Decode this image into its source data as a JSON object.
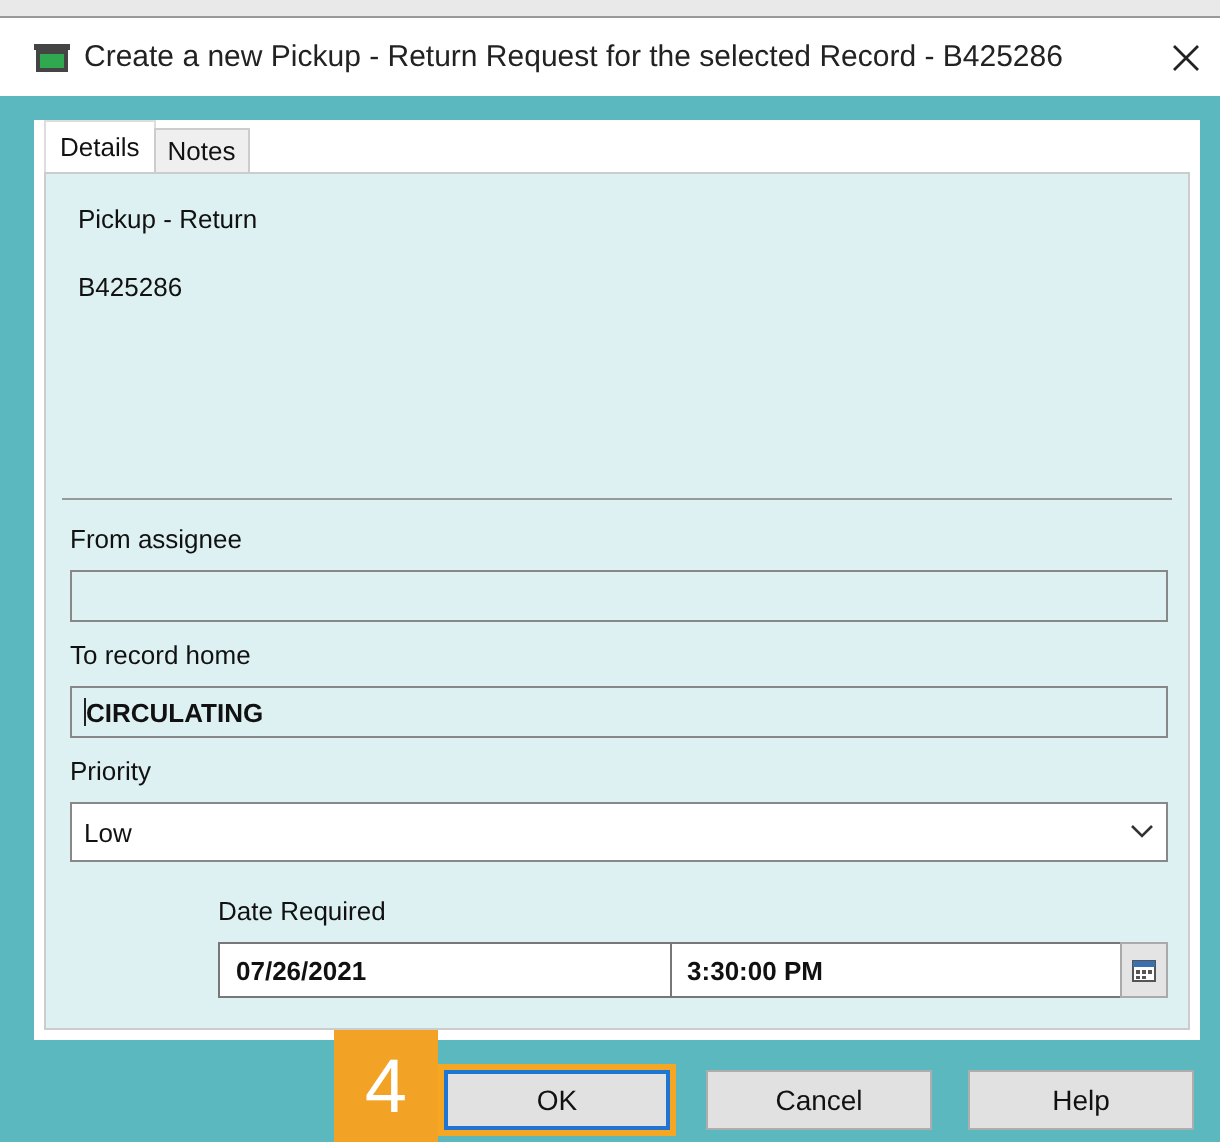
{
  "window": {
    "title": "Create a new Pickup - Return Request for the selected Record - B425286"
  },
  "tabs": [
    {
      "label": "Details",
      "selected": true
    },
    {
      "label": "Notes",
      "selected": false
    }
  ],
  "request_type": "Pickup - Return",
  "record_number": "B425286",
  "fields": [
    {
      "label": "From assignee"
    },
    {
      "label": "To record home",
      "value": "CIRCULATING"
    }
  ],
  "priority": {
    "label": "Priority",
    "value": "Low"
  },
  "date_required": {
    "label": "Date Required",
    "date": "07/26/2021",
    "time": "3:30:00 PM"
  },
  "buttons": [
    {
      "label": "OK",
      "focused": true,
      "highlighted": true
    },
    {
      "label": "Cancel",
      "focused": false,
      "highlighted": false
    },
    {
      "label": "Help",
      "focused": false,
      "highlighted": false
    }
  ],
  "step_badge": {
    "label": "4"
  }
}
